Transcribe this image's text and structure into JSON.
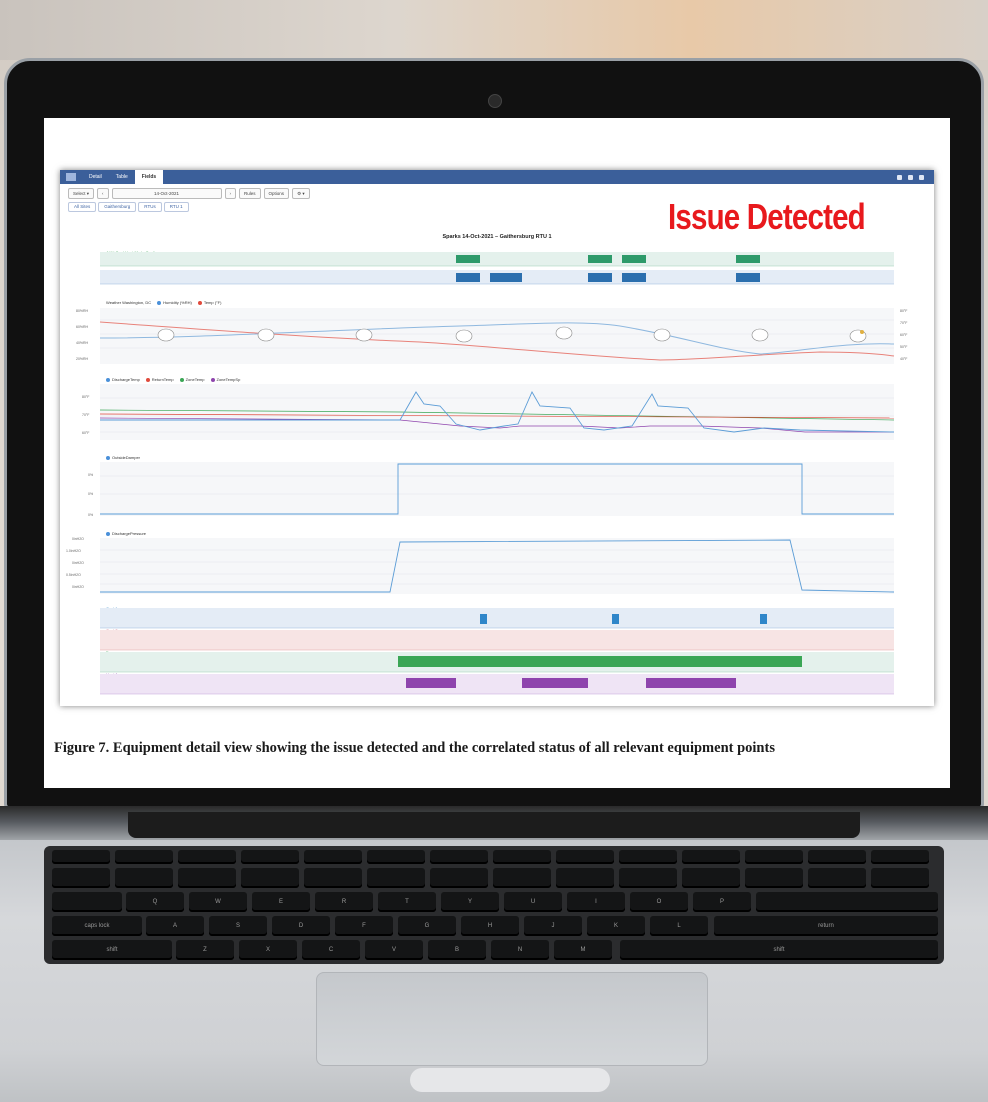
{
  "app": {
    "tabs": [
      "Detail",
      "Table",
      "Fields"
    ],
    "active_tab": "Fields"
  },
  "toolbar": {
    "select_label": "Select ▾",
    "prev": "‹",
    "date": "14-Oct-2021",
    "next": "›",
    "rules": "Rules",
    "options": "Options",
    "gear": "⚙ ▾"
  },
  "breadcrumbs": [
    "All Sites",
    "Gaithersburg",
    "RTUs",
    "RTU 1"
  ],
  "overlay_text": "Issue Detected",
  "chart_title": "Sparks 14-Oct-2021 – Gaithersburg RTU 1",
  "spark_rows": [
    "AHU Cool Heat Mode Cooling",
    "AHU Outside Damper Stuck Open"
  ],
  "weather": {
    "title": "Weather Washington, DC",
    "series": [
      "Humidity (%RH)",
      "Temp (°F)"
    ],
    "colors": [
      "#4a90d9",
      "#e04a3c"
    ]
  },
  "temps": {
    "series": [
      "DischargeTemp",
      "ReturnTemp",
      "ZoneTemp",
      "ZoneTempSp"
    ],
    "colors": [
      "#4a90d9",
      "#e04a3c",
      "#3aa655",
      "#8e44ad"
    ]
  },
  "damper": {
    "series": "OutsideDamper",
    "ticks": [
      "0%",
      "0%",
      "0%"
    ]
  },
  "pressure": {
    "series": "DischargePressure",
    "ticks": [
      "0inH2O",
      "1.0inH2O",
      "0inH2O",
      "0.5inH2O",
      "0inH2O"
    ]
  },
  "status_rows": [
    "Cool 1",
    "Cool 2",
    "Fan",
    "Heat 1"
  ],
  "status_colors": [
    "#2f86c9",
    "#e3a2a2",
    "#3aa655",
    "#8e44ad"
  ],
  "caption": "Figure 7. Equipment detail view showing the issue detected and the correlated status of all relevant equipment points",
  "keyboard": {
    "row2": [
      "Q",
      "W",
      "E",
      "R",
      "T",
      "Y",
      "U",
      "I",
      "O",
      "P"
    ],
    "row3": [
      "A",
      "S",
      "D",
      "F",
      "G",
      "H",
      "J",
      "K",
      "L"
    ],
    "row4": [
      "Z",
      "X",
      "C",
      "V",
      "B",
      "N",
      "M"
    ],
    "caps": "caps lock",
    "shift": "shift",
    "return": "return"
  }
}
